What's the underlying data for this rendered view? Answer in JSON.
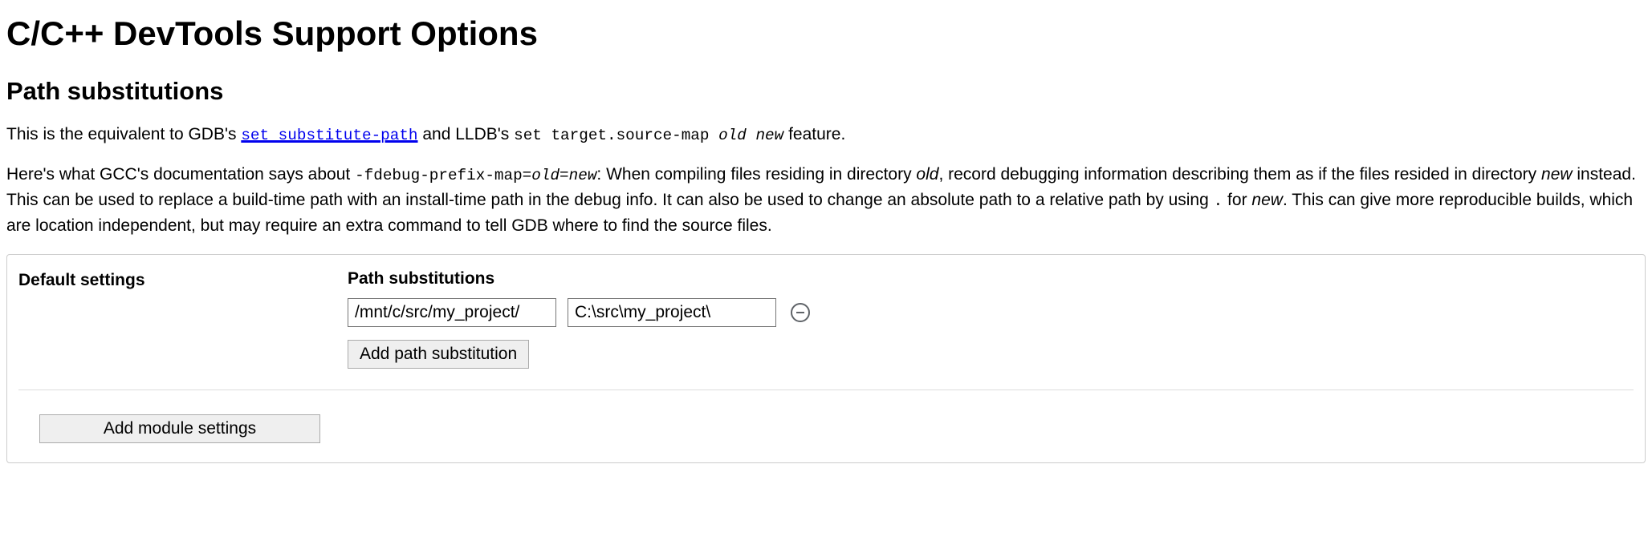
{
  "page_title": "C/C++ DevTools Support Options",
  "section_heading": "Path substitutions",
  "paragraph1": {
    "t1": "This is the equivalent to GDB's ",
    "link_text": "set substitute-path",
    "t2": " and LLDB's ",
    "code_text": "set target.source-map ",
    "em1": "old",
    "space": " ",
    "em2": "new",
    "t3": " feature."
  },
  "paragraph2": {
    "t1": "Here's what GCC's documentation says about ",
    "code_prefix": "-fdebug-prefix-map=",
    "em_old": "old",
    "eq": "=",
    "em_new": "new",
    "t2": ": When compiling files residing in directory ",
    "em_old2": "old",
    "t3": ", record debugging information describing them as if the files resided in directory ",
    "em_new2": "new",
    "t4": " instead. This can be used to replace a build-time path with an install-time path in the debug info. It can also be used to change an absolute path to a relative path by using ",
    "code_dot": ".",
    "t5": " for ",
    "em_new3": "new",
    "t6": ". This can give more reproducible builds, which are location independent, but may require an extra command to tell GDB where to find the source files."
  },
  "settings": {
    "default_label": "Default settings",
    "sub_label": "Path substitutions",
    "row": {
      "from": "/mnt/c/src/my_project/",
      "to": "C:\\src\\my_project\\"
    },
    "add_path_label": "Add path substitution",
    "add_module_label": "Add module settings"
  }
}
